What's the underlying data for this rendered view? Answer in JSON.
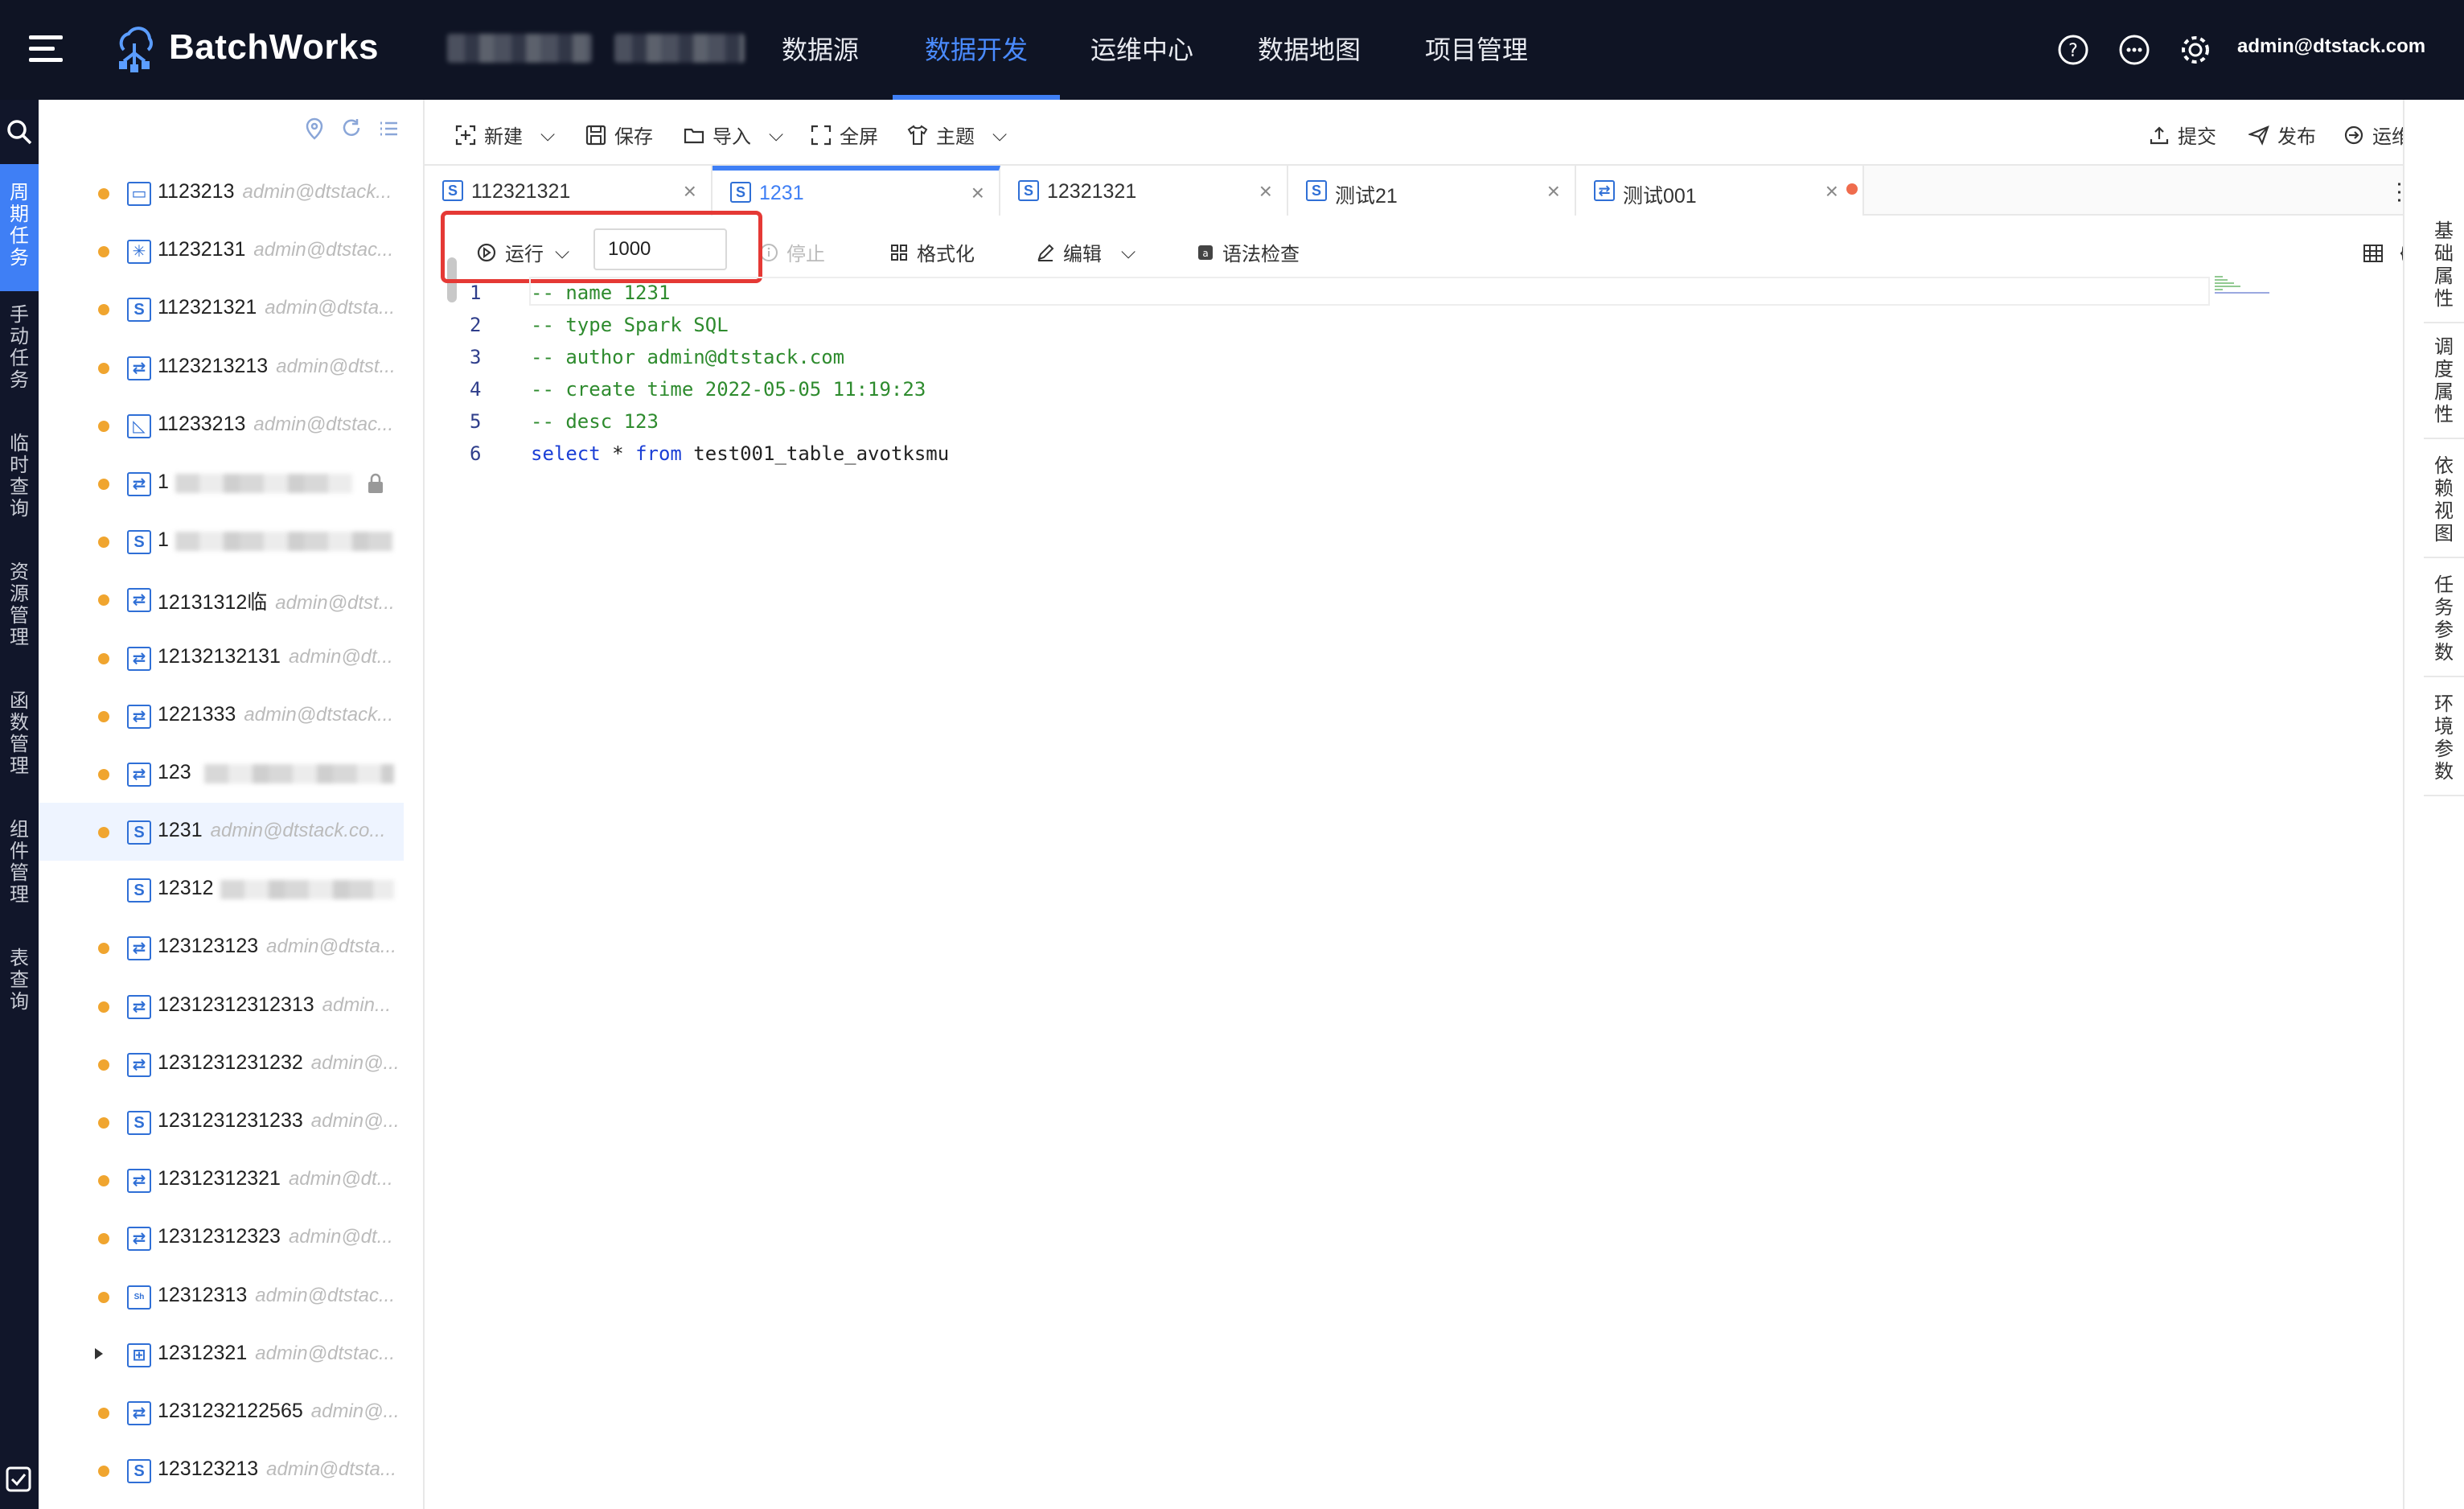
{
  "header": {
    "brand": "BatchWorks",
    "nav": [
      "数据源",
      "数据开发",
      "运维中心",
      "数据地图",
      "项目管理"
    ],
    "active_nav": "数据开发",
    "user": "admin@dtstack.com"
  },
  "rail": {
    "items": [
      "周期任务",
      "手动任务",
      "临时查询",
      "资源管理",
      "函数管理",
      "组件管理",
      "表查询"
    ]
  },
  "tree": {
    "items": [
      {
        "name": "1123213",
        "owner": "admin@dtstack..."
      },
      {
        "name": "11232131",
        "owner": "admin@dtstac..."
      },
      {
        "name": "112321321",
        "owner": "admin@dtsta..."
      },
      {
        "name": "1123213213",
        "owner": "admin@dtst..."
      },
      {
        "name": "11233213",
        "owner": "admin@dtstac..."
      },
      {
        "name": "1",
        "owner": ""
      },
      {
        "name": "1",
        "owner": ""
      },
      {
        "name": "12131312临",
        "owner": "admin@dtst..."
      },
      {
        "name": "12132132131",
        "owner": "admin@dt..."
      },
      {
        "name": "1221333",
        "owner": "admin@dtstack..."
      },
      {
        "name": "123",
        "owner": ""
      },
      {
        "name": "1231",
        "owner": "admin@dtstack.co..."
      },
      {
        "name": "12312",
        "owner": ""
      },
      {
        "name": "123123123",
        "owner": "admin@dtsta..."
      },
      {
        "name": "12312312312313",
        "owner": "admin..."
      },
      {
        "name": "1231231231232",
        "owner": "admin@..."
      },
      {
        "name": "1231231231233",
        "owner": "admin@..."
      },
      {
        "name": "12312312321",
        "owner": "admin@dt..."
      },
      {
        "name": "12312312323",
        "owner": "admin@dt..."
      },
      {
        "name": "12312313",
        "owner": "admin@dtstac..."
      },
      {
        "name": "12312321",
        "owner": "admin@dtstac..."
      },
      {
        "name": "1231232122565",
        "owner": "admin@..."
      },
      {
        "name": "123123213",
        "owner": "admin@dtsta..."
      }
    ]
  },
  "toolbar": {
    "new": "新建",
    "save": "保存",
    "import": "导入",
    "fullscreen": "全屏",
    "theme": "主题",
    "submit": "提交",
    "publish": "发布",
    "ops": "运维"
  },
  "tabs": [
    {
      "label": "112321321"
    },
    {
      "label": "1231"
    },
    {
      "label": "12321321"
    },
    {
      "label": "测试21"
    },
    {
      "label": "测试001"
    }
  ],
  "editor": {
    "run": "运行",
    "limit": "1000",
    "stop": "停止",
    "format": "格式化",
    "edit": "编辑",
    "syntax_check": "语法检查",
    "lines": [
      {
        "no": "1",
        "text": "-- name 1231"
      },
      {
        "no": "2",
        "text": "-- type Spark SQL"
      },
      {
        "no": "3",
        "text": "-- author admin@dtstack.com"
      },
      {
        "no": "4",
        "text": "-- create time 2022-05-05 11:19:23"
      },
      {
        "no": "5",
        "text": "-- desc 123"
      }
    ],
    "last_line": {
      "no": "6",
      "kw1": "select",
      "star": " * ",
      "kw2": "from",
      "table": " test001_table_avotksmu"
    }
  },
  "right_panel": {
    "tabs": [
      "基础属性",
      "调度属性",
      "依赖视图",
      "任务参数",
      "环境参数"
    ]
  }
}
